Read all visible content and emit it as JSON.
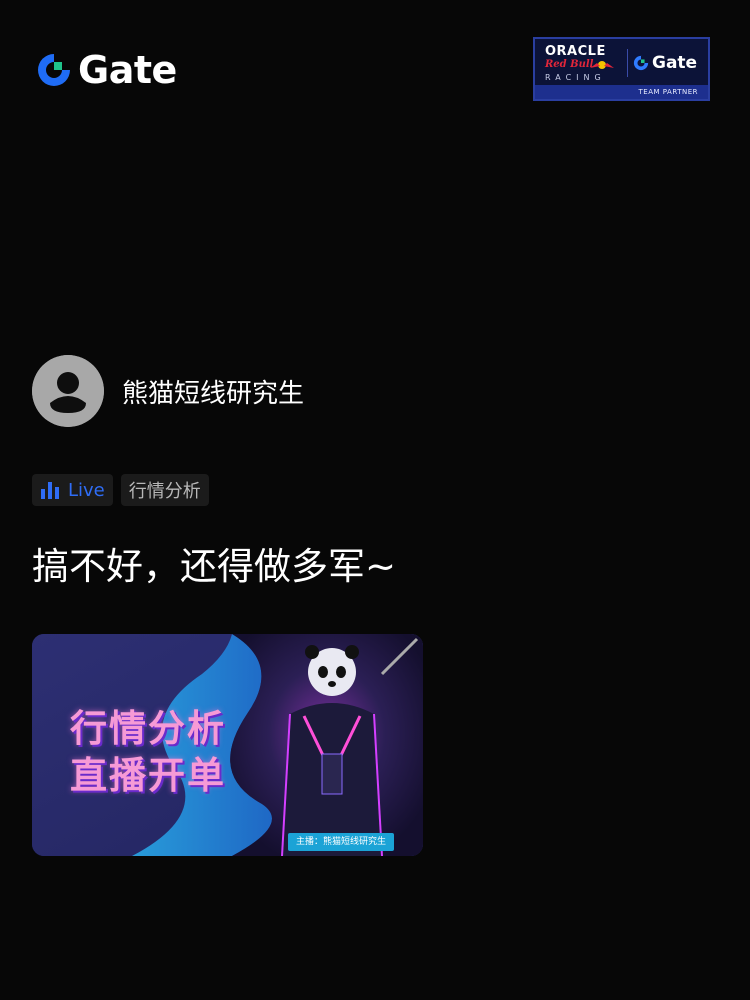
{
  "brand": {
    "name": "Gate",
    "accent": "#1f6cf5",
    "accent_green": "#1fc38b"
  },
  "partner_badge": {
    "oracle": "ORACLE",
    "redbull": "Red Bull",
    "racing": "RACING",
    "gate": "Gate",
    "team_partner": "TEAM PARTNER"
  },
  "post": {
    "author": "熊猫短线研究生",
    "tags": [
      {
        "label": "Live",
        "icon": "bar-chart-icon",
        "color": "#2f6df6"
      },
      {
        "label": "行情分析"
      }
    ],
    "title": "搞不好，还得做多军~",
    "cover": {
      "line1": "行情分析",
      "line2": "直播开单",
      "host": "主播：熊猫短线研究生"
    }
  }
}
